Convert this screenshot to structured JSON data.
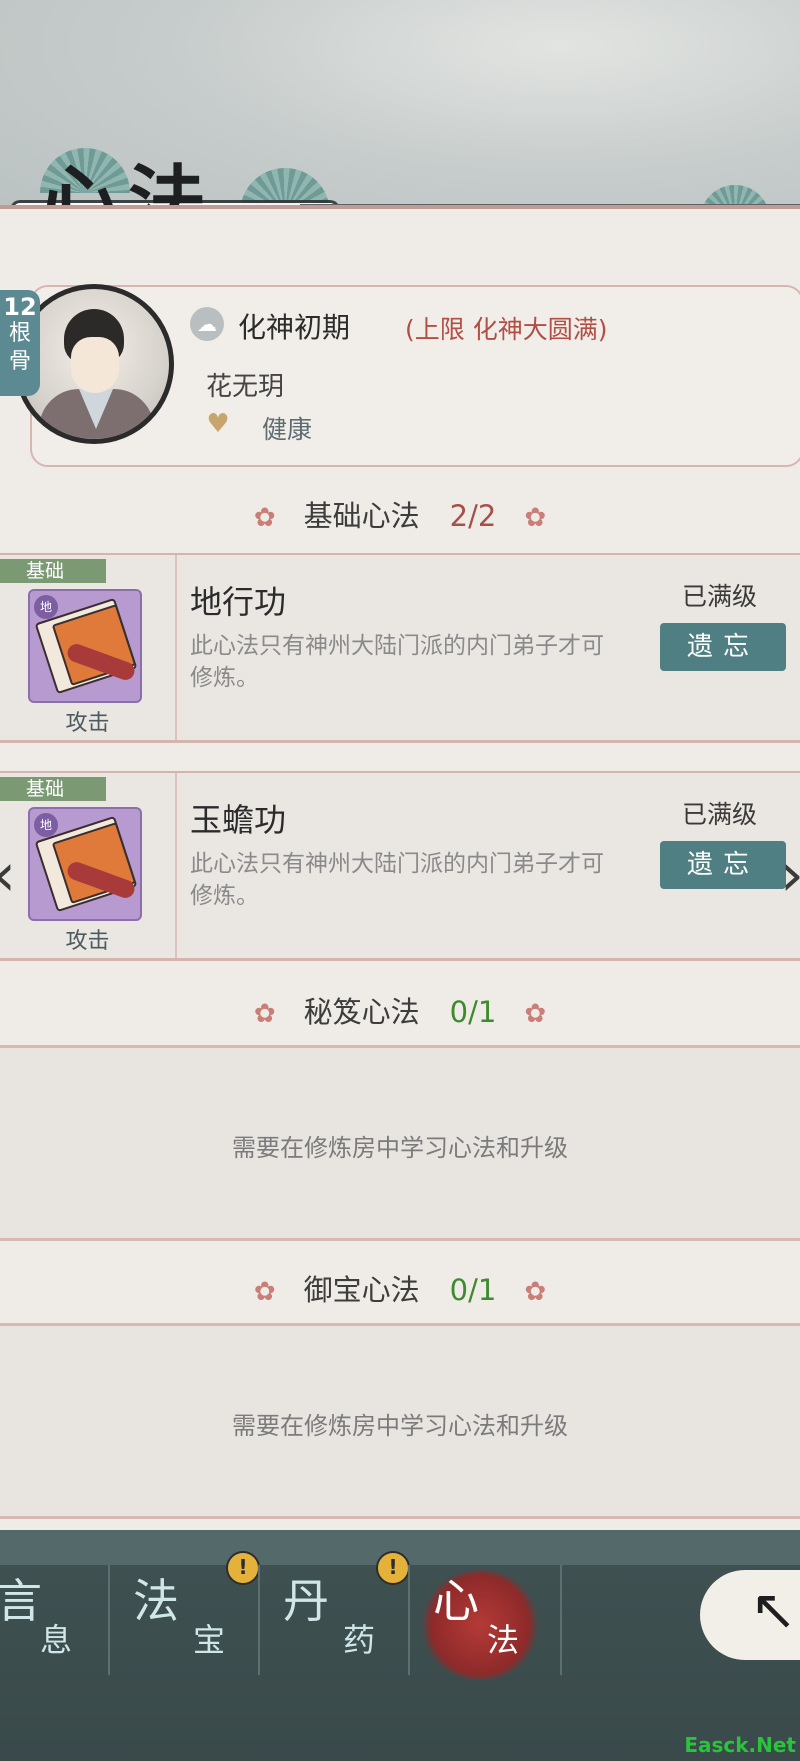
{
  "header": {
    "title": "心法"
  },
  "character": {
    "root_value": "12",
    "root_label": "根骨",
    "realm": "化神初期",
    "realm_limit": "(上限 化神大圆满)",
    "name": "花无玥",
    "health": "健康"
  },
  "sections": {
    "basic": {
      "title": "基础心法",
      "count": "2/2"
    },
    "secret": {
      "title": "秘笈心法",
      "count": "0/1",
      "empty_text": "需要在修炼房中学习心法和升级"
    },
    "treasure": {
      "title": "御宝心法",
      "count": "0/1",
      "empty_text": "需要在修炼房中学习心法和升级"
    }
  },
  "skills": [
    {
      "tag": "基础",
      "book_badge": "地",
      "type": "攻击",
      "name": "地行功",
      "desc": "此心法只有神州大陆门派的内门弟子才可修炼。",
      "level": "已满级",
      "action": "遗忘"
    },
    {
      "tag": "基础",
      "book_badge": "地",
      "type": "攻击",
      "name": "玉蟾功",
      "desc": "此心法只有神州大陆门派的内门弟子才可修炼。",
      "level": "已满级",
      "action": "遗忘"
    }
  ],
  "nav": {
    "items": [
      {
        "big": "言",
        "small": "息"
      },
      {
        "big": "法",
        "small": "宝",
        "alert": "!"
      },
      {
        "big": "丹",
        "small": "药",
        "alert": "!"
      },
      {
        "big": "心",
        "small": "法"
      }
    ],
    "active_index": 3
  },
  "icons": {
    "realm": "cloud-icon",
    "health": "heart-icon",
    "flower": "flower-icon",
    "back": "back-arrow-icon"
  },
  "colors": {
    "accent": "#4f7f83",
    "count_full": "#a7504a",
    "count_empty": "#3e8a2e",
    "limit_text": "#b24f45",
    "nav_active": "#b43a36"
  },
  "watermark": "Easck.Net"
}
